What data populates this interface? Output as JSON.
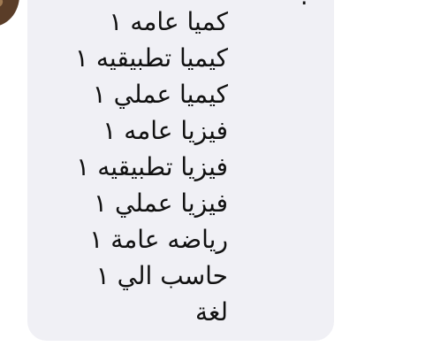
{
  "message": {
    "top_partial_text": "؟",
    "lines": [
      "كميا عامه ١",
      "كيميا تطبيقيه ١",
      "كيميا عملي ١",
      "فيزيا عامه ١",
      "فيزيا تطبيقيه ١",
      "فيزيا عملي ١",
      "رياضه عامة ١",
      "حاسب الي ١",
      "لغة"
    ]
  }
}
